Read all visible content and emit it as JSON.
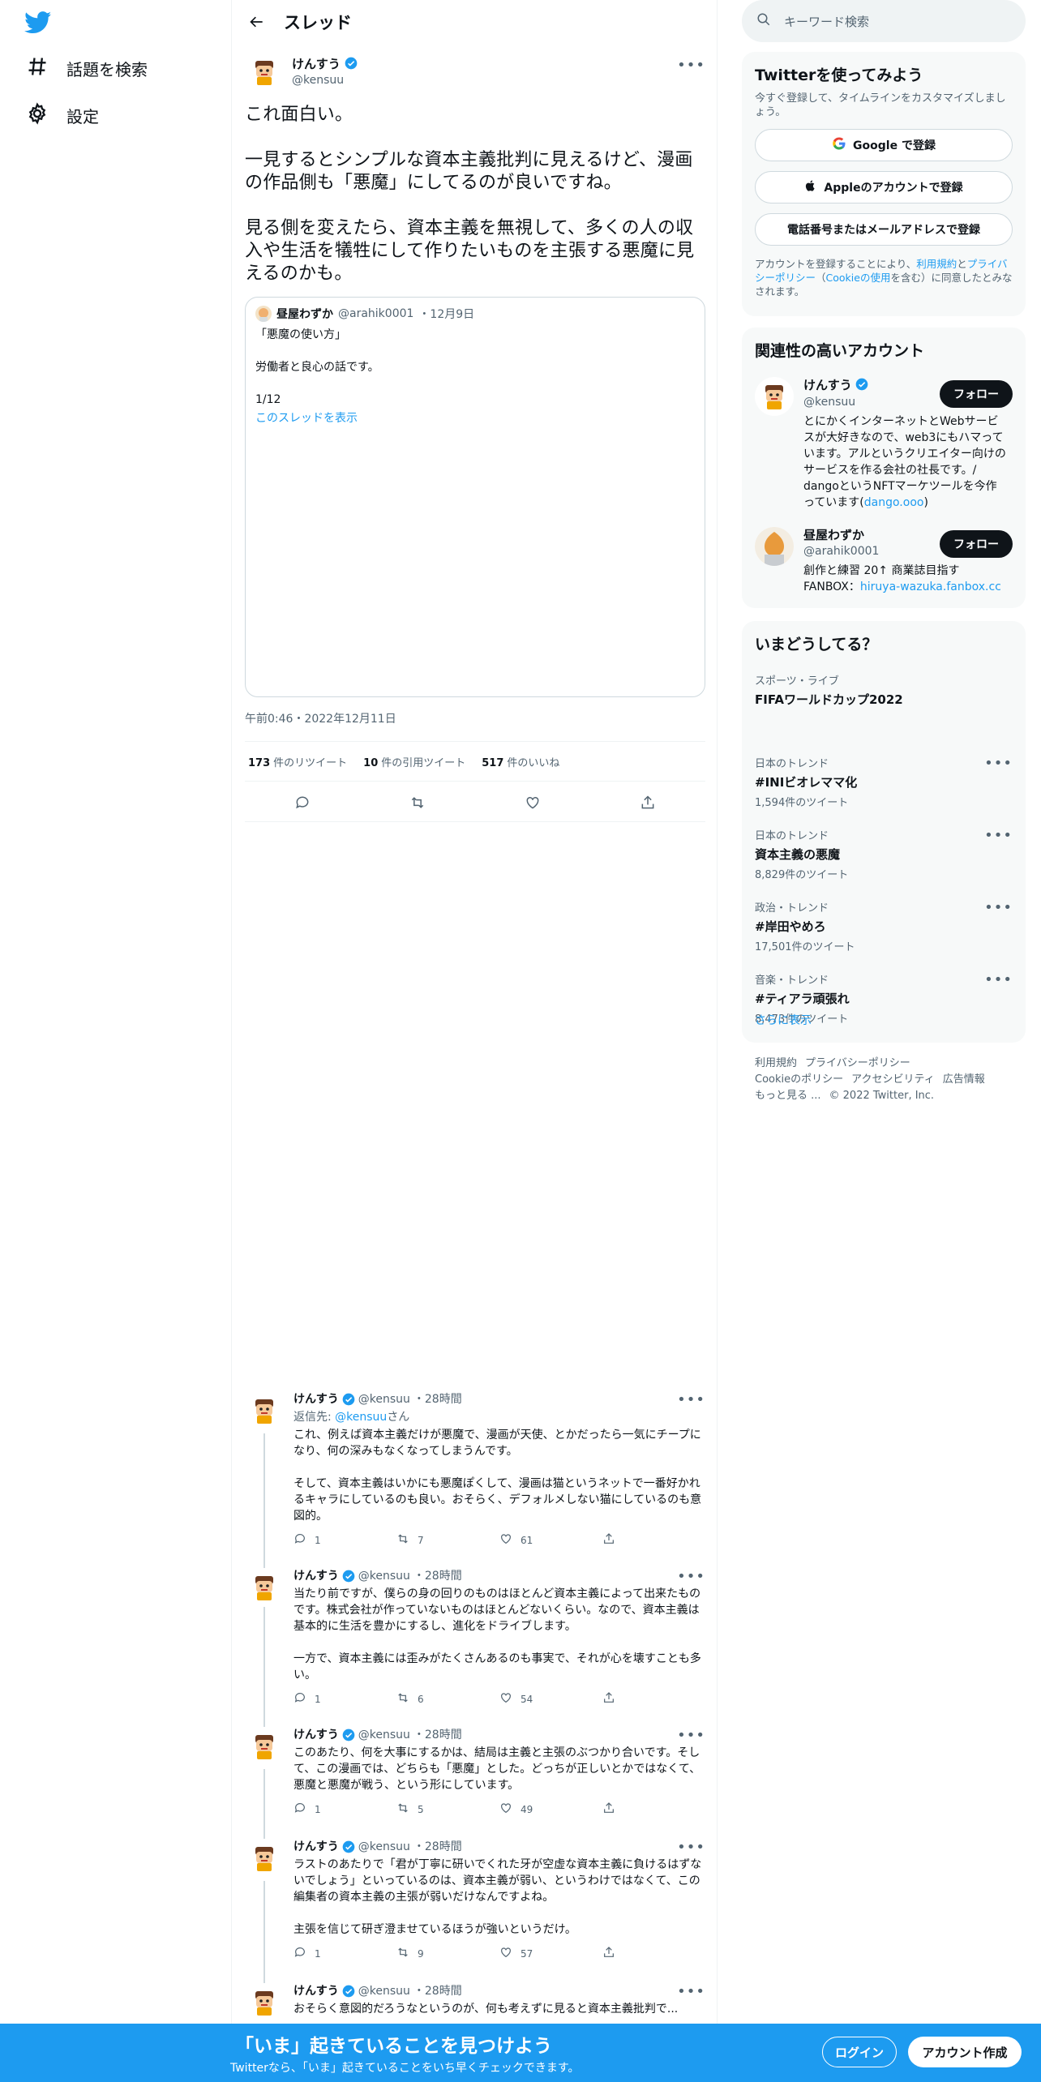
{
  "nav": {
    "explore": "話題を検索",
    "settings": "設定"
  },
  "thread": {
    "title": "スレッド"
  },
  "main_tweet": {
    "name": "けんすう",
    "handle": "@kensuu",
    "text": "これ面白い。\n\n一見するとシンプルな資本主義批判に見えるけど、漫画の作品側も「悪魔」にしてるのが良いですね。\n\n見る側を変えたら、資本主義を無視して、多くの人の収入や生活を犠牲にして作りたいものを主張する悪魔に見えるのかも。",
    "time": "午前0:46・2022年12月11日",
    "retweets": "173",
    "retweets_label": "件のリツイート",
    "quotes": "10",
    "quotes_label": "件の引用ツイート",
    "likes": "517",
    "likes_label": "件のいいね"
  },
  "quote": {
    "name": "昼屋わずか",
    "handle": "@arahik0001",
    "date": "・12月9日",
    "text": "「悪魔の使い方」\n\n労働者と良心の話です。\n\n1/12",
    "show_thread": "このスレッドを表示"
  },
  "replies": [
    {
      "name": "けんすう",
      "handle": "@kensuu",
      "time": "・28時間",
      "reply_to_prefix": "返信先: ",
      "reply_to_handle": "@kensuu",
      "reply_to_suffix": "さん",
      "text": "これ、例えば資本主義だけが悪魔で、漫画が天使、とかだったら一気にチープになり、何の深みもなくなってしまうんです。\n\nそして、資本主義はいかにも悪魔ぽくして、漫画は猫というネットで一番好かれるキャラにしているのも良い。おそらく、デフォルメしない猫にしているのも意図的。",
      "replies": "1",
      "retweets": "7",
      "likes": "61"
    },
    {
      "name": "けんすう",
      "handle": "@kensuu",
      "time": "・28時間",
      "text": "当たり前ですが、僕らの身の回りのものはほとんど資本主義によって出来たものです。株式会社が作っていないものはほとんどないくらい。なので、資本主義は基本的に生活を豊かにするし、進化をドライブします。\n\n一方で、資本主義には歪みがたくさんあるのも事実で、それが心を壊すことも多い。",
      "replies": "1",
      "retweets": "6",
      "likes": "54"
    },
    {
      "name": "けんすう",
      "handle": "@kensuu",
      "time": "・28時間",
      "text": "このあたり、何を大事にするかは、結局は主義と主張のぶつかり合いです。そして、この漫画では、どちらも「悪魔」とした。どっちが正しいとかではなくて、悪魔と悪魔が戦う、という形にしています。",
      "replies": "1",
      "retweets": "5",
      "likes": "49"
    },
    {
      "name": "けんすう",
      "handle": "@kensuu",
      "time": "・28時間",
      "text": "ラストのあたりで「君が丁寧に研いでくれた牙が空虚な資本主義に負けるはずないでしょう」といっているのは、資本主義が弱い、というわけではなくて、この編集者の資本主義の主張が弱いだけなんですよね。\n\n主張を信じて研ぎ澄ませているほうが強いというだけ。",
      "replies": "1",
      "retweets": "9",
      "likes": "57"
    },
    {
      "name": "けんすう",
      "handle": "@kensuu",
      "time": "・28時間",
      "text": "おそらく意図的だろうなというのが、何も考えずに見ると資本主義批判で..."
    }
  ],
  "sidebar": {
    "search_placeholder": "キーワード検索",
    "signup": {
      "title": "Twitterを使ってみよう",
      "subtitle": "今すぐ登録して、タイムラインをカスタマイズしましょう。",
      "google": "Google で登録",
      "apple": "Appleのアカウントで登録",
      "phone": "電話番号またはメールアドレスで登録",
      "terms_1": "アカウントを登録することにより、",
      "terms_link1": "利用規約",
      "terms_2": "と",
      "terms_link2": "プライバシーポリシー",
      "terms_3": "（",
      "terms_link3": "Cookieの使用",
      "terms_4": "を含む）に同意したとみなされます。"
    },
    "related": {
      "title": "関連性の高いアカウント",
      "follow": "フォロー",
      "accounts": [
        {
          "name": "けんすう",
          "handle": "@kensuu",
          "bio": "とにかくインターネットとWebサービスが大好きなので、web3にもハマっています。アルというクリエイター向けのサービスを作る会社の社長です。/ dangoというNFTマーケツールを今作っています(",
          "bio_link": "dango.ooo",
          "bio_end": ")"
        },
        {
          "name": "昼屋わずか",
          "handle": "@arahik0001",
          "bio": "創作と練習 20↑ 商業誌目指す\nFANBOX：",
          "bio_link": "hiruya-wazuka.fanbox.cc",
          "bio_end": ""
        }
      ]
    },
    "trends": {
      "title": "いまどうしてる？",
      "items": [
        {
          "context": "スポーツ・ライブ",
          "title": "FIFAワールドカップ2022",
          "count": ""
        },
        {
          "context": "日本のトレンド",
          "title": "#INIビオレママ化",
          "count": "1,594件のツイート"
        },
        {
          "context": "日本のトレンド",
          "title": "資本主義の悪魔",
          "count": "8,829件のツイート"
        },
        {
          "context": "政治・トレンド",
          "title": "#岸田やめろ",
          "count": "17,501件のツイート"
        },
        {
          "context": "音楽・トレンド",
          "title": "#ティアラ頑張れ",
          "count": "8,473件のツイート"
        }
      ],
      "show_more": "さらに表示"
    },
    "footer": {
      "links": [
        "利用規約",
        "プライバシーポリシー",
        "Cookieのポリシー",
        "アクセシビリティ",
        "広告情報",
        "もっと見る ..."
      ],
      "copyright": "© 2022 Twitter, Inc."
    }
  },
  "banner": {
    "title": "「いま」起きていることを見つけよう",
    "subtitle": "Twitterなら、「いま」起きていることをいち早くチェックできます。",
    "login": "ログイン",
    "signup": "アカウント作成"
  },
  "colors": {
    "accent": "#1d9bf0",
    "text": "#0f1419",
    "secondary": "#536471"
  }
}
